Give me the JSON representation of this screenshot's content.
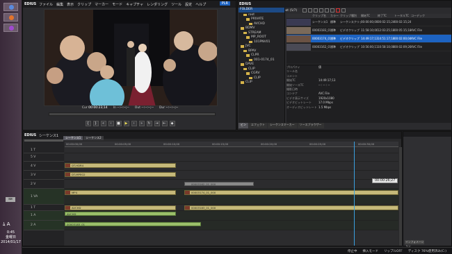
{
  "taskbar": {
    "time": "0:45",
    "day": "金曜日",
    "date": "2014/01/17"
  },
  "player": {
    "app": "EDIUS",
    "menu": [
      "ファイル",
      "編集",
      "表示",
      "クリップ",
      "マーカー",
      "モード",
      "キャプチャ",
      "レンダリング",
      "ツール",
      "設定",
      "ヘルプ"
    ],
    "badge": "PLR",
    "tc": [
      {
        "label": "Cur",
        "value": "00:00:23;14"
      },
      {
        "label": "In",
        "value": "--:--:--;--"
      },
      {
        "label": "Out",
        "value": "--:--:--;--"
      },
      {
        "label": "Dur",
        "value": "--:--:--;--"
      }
    ]
  },
  "bin": {
    "app": "EDIUS",
    "path": "root (5/7)",
    "folders": [
      {
        "label": "FOLDER",
        "header": true
      },
      {
        "label": "root"
      },
      {
        "label": "PRIVATE"
      },
      {
        "label": "AVCHD"
      },
      {
        "label": "BDMV"
      },
      {
        "label": "STREAM"
      },
      {
        "label": "MP_ROOT"
      },
      {
        "label": "101PNV01"
      },
      {
        "label": "JVC"
      },
      {
        "label": "BPAV"
      },
      {
        "label": "CLPR"
      },
      {
        "label": "001-0174_01"
      },
      {
        "label": "DAVE"
      },
      {
        "label": "CLIP"
      },
      {
        "label": "CGRV"
      },
      {
        "label": "CLIP"
      },
      {
        "label": "CLIP"
      }
    ],
    "columns": [
      "クリップ名",
      "カラー",
      "クリップ種別",
      "開始TC",
      "終了TC",
      "トータルTC",
      "コーデック"
    ],
    "clips": [
      {
        "name": "シーケンス1",
        "color": "標準",
        "type": "シーケンスクリップ",
        "start": "00:00:00;00",
        "end": "00:02:15;24",
        "total": "00:02:15;24",
        "codec": "",
        "selected": false
      },
      {
        "name": "00003183_01_000",
        "color": "標準",
        "type": "ビデオクリップ",
        "start": "11:58:10;00",
        "end": "12:03:25;18",
        "total": "00:05:15;18",
        "codec": "AVC File",
        "selected": false
      },
      {
        "name": "00003174_01_000",
        "color": "標準",
        "type": "ビデオクリップ",
        "start": "14:49:17;13",
        "end": "14:51:17;18",
        "total": "00:02:00;04",
        "codec": "AVC File",
        "selected": true
      },
      {
        "name": "00003162_01_000",
        "color": "標準",
        "type": "ビデオクリップ",
        "start": "10:56:00;11",
        "end": "10:58:10;08",
        "total": "00:02:09;26",
        "codec": "AVC File",
        "selected": false
      }
    ],
    "properties": [
      {
        "k": "プロパティ",
        "v": "値"
      },
      {
        "k": "リール名",
        "v": ""
      },
      {
        "k": "コメント",
        "v": ""
      },
      {
        "k": "開始TC",
        "v": "14:49:17;13"
      },
      {
        "k": "開始ソースTC",
        "v": "-- : -- : --"
      },
      {
        "k": "撮影日時",
        "v": ""
      },
      {
        "k": "コンテナ",
        "v": "AVC File"
      },
      {
        "k": "ビデオ表示サイズ",
        "v": "1920x1080"
      },
      {
        "k": "ビデオビットレート",
        "v": "17.0 Mbps"
      },
      {
        "k": "オーディオビットレート",
        "v": "1.5 Mbps"
      }
    ],
    "tabs": [
      "ビン",
      "エフェクト",
      "シーケンスマーカー",
      "ソースブラウザー"
    ]
  },
  "timeline": {
    "app": "EDIUS",
    "seq_title": "シーケンス1",
    "tabs": [
      "シーケンス1",
      "シーケンス2"
    ],
    "ruler": [
      "00:00:00;00",
      "00:00:05;00",
      "00:00:10;00",
      "00:00:15;00",
      "00:00:20;00",
      "00:00:25;00",
      "00:00:30;00"
    ],
    "tracks": [
      "1 T",
      "5 V",
      "4 V",
      "3 V",
      "2 V",
      "1 VA",
      "1 T",
      "1 A",
      "2 A"
    ],
    "clips": [
      {
        "track": 2,
        "label": "DT-HDR4",
        "kind": "v"
      },
      {
        "track": 3,
        "label": "DT-MPEG2",
        "kind": "v"
      },
      {
        "track": 4,
        "label": "00003162_01_000",
        "kind": "t"
      },
      {
        "track": 5,
        "label": "MP4",
        "kind": "v"
      },
      {
        "track": 5,
        "label": "00003174_01_000",
        "kind": "v"
      },
      {
        "track": 6,
        "label": "AVCHD",
        "kind": "v"
      },
      {
        "track": 6,
        "label": "00003183_01_000",
        "kind": "v"
      },
      {
        "track": 6,
        "label": "AVCHD",
        "kind": "a"
      },
      {
        "track": 8,
        "label": "00003183_01",
        "kind": "a"
      }
    ],
    "current_tc": "00:00:26;27"
  },
  "info_panel": {
    "tab": "インフォメーション"
  },
  "statusbar": {
    "items": [
      "停止中",
      "挿入モード",
      "リップルOFF",
      "ディスク 76%使用済み(C:)"
    ]
  },
  "colors": {
    "accent": "#1d63c2",
    "video_clip": "#c6b97a",
    "audio_clip": "#9bc06a",
    "playhead": "#3aa0e0"
  }
}
